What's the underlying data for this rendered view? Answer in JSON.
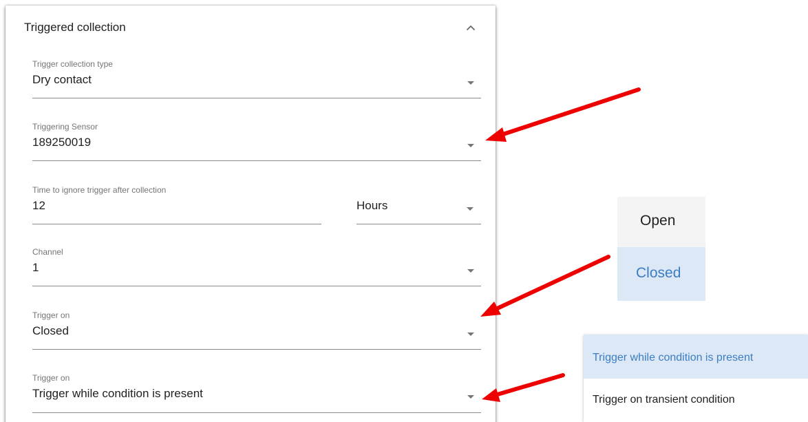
{
  "panel": {
    "title": "Triggered collection",
    "collapse_icon": "chevron-up-icon"
  },
  "fields": {
    "trigger_type": {
      "label": "Trigger collection type",
      "value": "Dry contact"
    },
    "sensor": {
      "label": "Triggering Sensor",
      "value": "189250019"
    },
    "ignore_time": {
      "label": "Time to ignore trigger after collection",
      "value": "12",
      "unit": "Hours"
    },
    "channel": {
      "label": "Channel",
      "value": "1"
    },
    "trigger_on_state": {
      "label": "Trigger on",
      "value": "Closed"
    },
    "trigger_on_condition": {
      "label": "Trigger on",
      "value": "Trigger while condition is present"
    }
  },
  "menus": {
    "state_options": [
      {
        "label": "Open",
        "selected": false
      },
      {
        "label": "Closed",
        "selected": true
      }
    ],
    "condition_options": [
      {
        "label": "Trigger while condition is present",
        "selected": true
      },
      {
        "label": "Trigger on transient condition",
        "selected": false
      }
    ]
  },
  "colors": {
    "arrow": "#ee0000",
    "selected_bg": "#dce8f5",
    "selected_text": "#3b7dc4",
    "menu_bg": "#f4f4f4"
  }
}
